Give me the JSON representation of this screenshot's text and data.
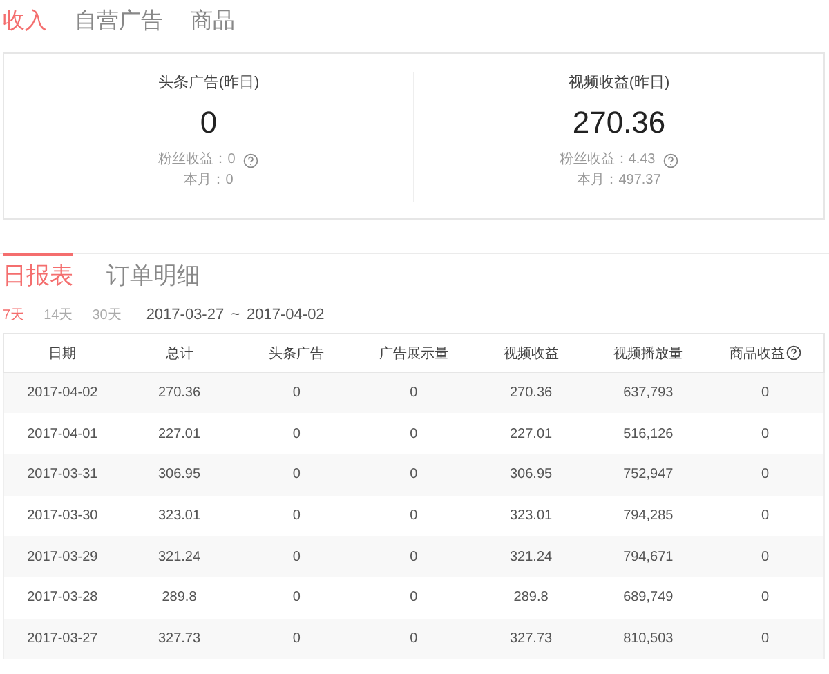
{
  "tabs": [
    {
      "label": "收入",
      "selected": true
    },
    {
      "label": "自营广告",
      "selected": false
    },
    {
      "label": "商品",
      "selected": false
    }
  ],
  "summary": [
    {
      "title": "头条广告(昨日)",
      "value": "0",
      "fans": "粉丝收益：0",
      "month": "本月：0"
    },
    {
      "title": "视频收益(昨日)",
      "value": "270.36",
      "fans": "粉丝收益：4.43",
      "month": "本月：497.37"
    }
  ],
  "report_tabs": [
    {
      "label": "日报表",
      "selected": true
    },
    {
      "label": "订单明细",
      "selected": false
    }
  ],
  "ranges": [
    {
      "label": "7天",
      "selected": true
    },
    {
      "label": "14天",
      "selected": false
    },
    {
      "label": "30天",
      "selected": false
    }
  ],
  "date_range": {
    "start": "2017-03-27",
    "separator": "~",
    "end": "2017-04-02"
  },
  "table": {
    "columns": [
      {
        "label": "日期",
        "help": false
      },
      {
        "label": "总计",
        "help": false
      },
      {
        "label": "头条广告",
        "help": false
      },
      {
        "label": "广告展示量",
        "help": false
      },
      {
        "label": "视频收益",
        "help": false
      },
      {
        "label": "视频播放量",
        "help": false
      },
      {
        "label": "商品收益",
        "help": true
      }
    ],
    "rows": [
      [
        "2017-04-02",
        "270.36",
        "0",
        "0",
        "270.36",
        "637,793",
        "0"
      ],
      [
        "2017-04-01",
        "227.01",
        "0",
        "0",
        "227.01",
        "516,126",
        "0"
      ],
      [
        "2017-03-31",
        "306.95",
        "0",
        "0",
        "306.95",
        "752,947",
        "0"
      ],
      [
        "2017-03-30",
        "323.01",
        "0",
        "0",
        "323.01",
        "794,285",
        "0"
      ],
      [
        "2017-03-29",
        "321.24",
        "0",
        "0",
        "321.24",
        "794,671",
        "0"
      ],
      [
        "2017-03-28",
        "289.8",
        "0",
        "0",
        "289.8",
        "689,749",
        "0"
      ],
      [
        "2017-03-27",
        "327.73",
        "0",
        "0",
        "327.73",
        "810,503",
        "0"
      ]
    ]
  }
}
